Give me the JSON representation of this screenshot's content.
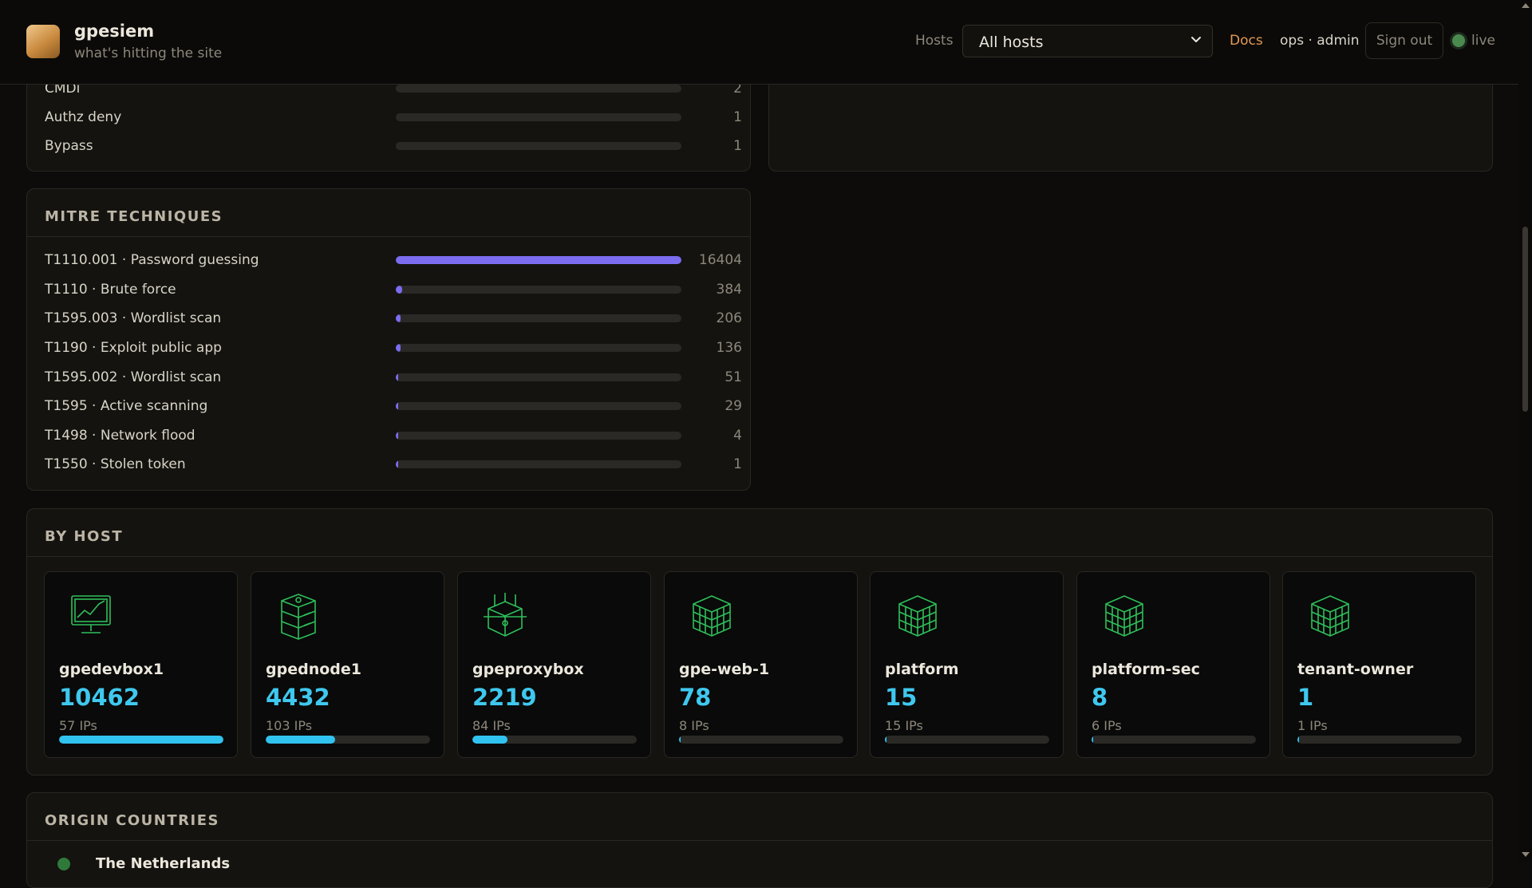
{
  "header": {
    "app_title": "gpesiem",
    "subtitle": "what's hitting the site",
    "hosts_label": "Hosts",
    "host_select_value": "All hosts",
    "docs_label": "Docs",
    "user_label": "ops · admin",
    "signout_label": "Sign out",
    "live_label": "live",
    "colors": {
      "accent": "#e39a55",
      "live": "#4a8a4e"
    }
  },
  "categories_panel": {
    "rows": [
      {
        "label": "CMDi",
        "count": "2",
        "fraction": 0.0
      },
      {
        "label": "Authz deny",
        "count": "1",
        "fraction": 0.0
      },
      {
        "label": "Bypass",
        "count": "1",
        "fraction": 0.0
      }
    ]
  },
  "mitre": {
    "title": "MITRE TECHNIQUES",
    "rows": [
      {
        "label": "T1110.001 · Password guessing",
        "count": "16404",
        "fraction": 1.0
      },
      {
        "label": "T1110 · Brute force",
        "count": "384",
        "fraction": 0.0234
      },
      {
        "label": "T1595.003 · Wordlist scan",
        "count": "206",
        "fraction": 0.0126
      },
      {
        "label": "T1190 · Exploit public app",
        "count": "136",
        "fraction": 0.0083
      },
      {
        "label": "T1595.002 · Wordlist scan",
        "count": "51",
        "fraction": 0.0031
      },
      {
        "label": "T1595 · Active scanning",
        "count": "29",
        "fraction": 0.0018
      },
      {
        "label": "T1498 · Network flood",
        "count": "4",
        "fraction": 0.0002
      },
      {
        "label": "T1550 · Stolen token",
        "count": "1",
        "fraction": 0.0001
      }
    ],
    "bar_color": "#7b6cf0"
  },
  "by_host": {
    "title": "BY HOST",
    "hosts": [
      {
        "name": "gpedevbox1",
        "count": "10462",
        "ips": "57 IPs",
        "fraction": 1.0,
        "icon": "monitor-icon"
      },
      {
        "name": "gpednode1",
        "count": "4432",
        "ips": "103 IPs",
        "fraction": 0.4236,
        "icon": "server-stack-icon"
      },
      {
        "name": "gpeproxybox",
        "count": "2219",
        "ips": "84 IPs",
        "fraction": 0.2121,
        "icon": "proxy-cube-icon"
      },
      {
        "name": "gpe-web-1",
        "count": "78",
        "ips": "8 IPs",
        "fraction": 0.0075,
        "icon": "server-cube-icon"
      },
      {
        "name": "platform",
        "count": "15",
        "ips": "15 IPs",
        "fraction": 0.0014,
        "icon": "server-cube-icon"
      },
      {
        "name": "platform-sec",
        "count": "8",
        "ips": "6 IPs",
        "fraction": 0.0008,
        "icon": "server-cube-icon"
      },
      {
        "name": "tenant-owner",
        "count": "1",
        "ips": "1 IPs",
        "fraction": 0.0001,
        "icon": "server-cube-icon"
      }
    ],
    "count_color": "#3fc8ef",
    "icon_color": "#2fbf5a"
  },
  "origin_countries": {
    "title": "ORIGIN COUNTRIES",
    "first_row_label": "The Netherlands"
  }
}
